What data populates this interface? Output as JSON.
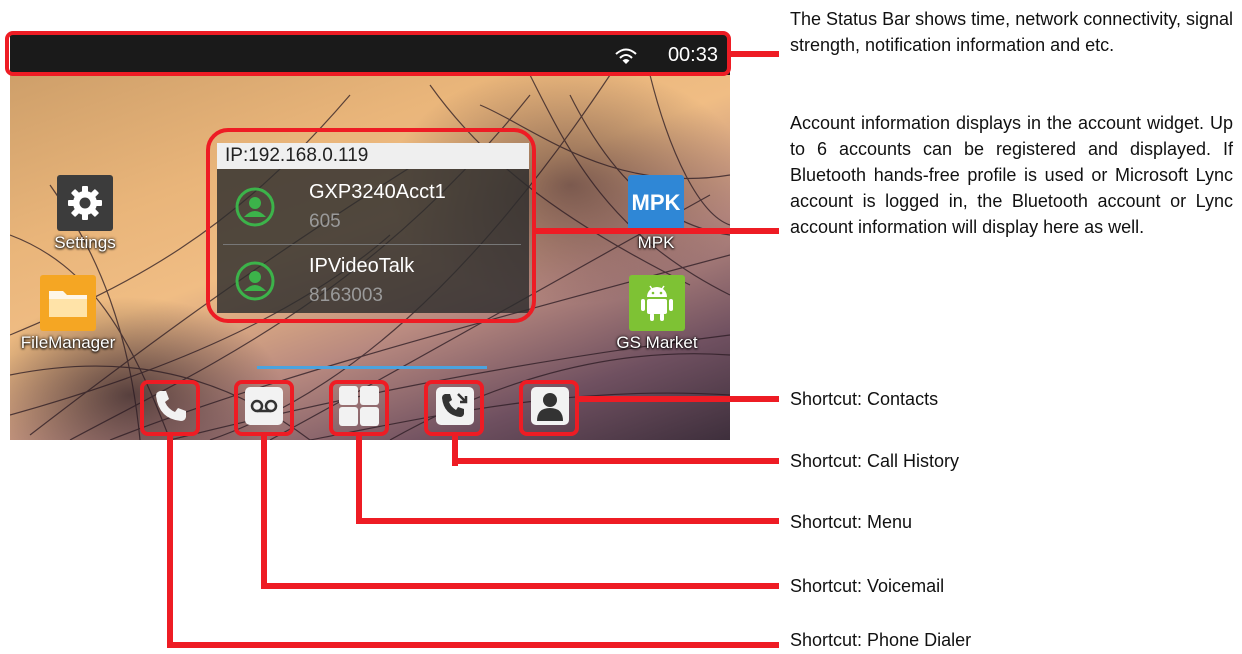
{
  "status_bar": {
    "time": "00:33",
    "icons": [
      "wifi-icon"
    ]
  },
  "apps": {
    "settings": {
      "label": "Settings",
      "icon": "gear-icon",
      "color": "#3c3c3c"
    },
    "file_manager": {
      "label": "FileManager",
      "icon": "folder-icon",
      "color": "#f5a623"
    },
    "mpk": {
      "label": "MPK",
      "tile_text": "MPK",
      "icon": "mpk-icon",
      "color": "#2f87d6"
    },
    "gs_market": {
      "label": "GS Market",
      "icon": "android-icon",
      "color": "#7ec234"
    }
  },
  "account_widget": {
    "ip": "IP:192.168.0.119",
    "accounts": [
      {
        "name": "GXP3240Acct1",
        "number": "605",
        "status_color": "#3cb34a"
      },
      {
        "name": "IPVideoTalk",
        "number": "8163003",
        "status_color": "#3cb34a"
      }
    ]
  },
  "dock": [
    {
      "icon": "phone-icon"
    },
    {
      "icon": "voicemail-icon"
    },
    {
      "icon": "menu-grid-icon"
    },
    {
      "icon": "call-history-icon"
    },
    {
      "icon": "contacts-icon"
    }
  ],
  "annotations": {
    "status_bar": "The Status Bar shows time, network connectivity, signal strength, notification information and etc.",
    "account_widget": "Account information displays in the account widget. Up to 6 accounts can be registered and displayed. If Bluetooth hands-free profile is used or Microsoft Lync account is logged in, the Bluetooth account or Lync account information will display here as well.",
    "contacts": "Shortcut: Contacts",
    "call_history": "Shortcut: Call History",
    "menu": "Shortcut: Menu",
    "voicemail": "Shortcut: Voicemail",
    "phone_dialer": "Shortcut: Phone Dialer"
  },
  "colors": {
    "annotation_red": "#ee1c24",
    "status_bar_bg": "#1a1a1a",
    "widget_accent": "#4aa3df"
  }
}
